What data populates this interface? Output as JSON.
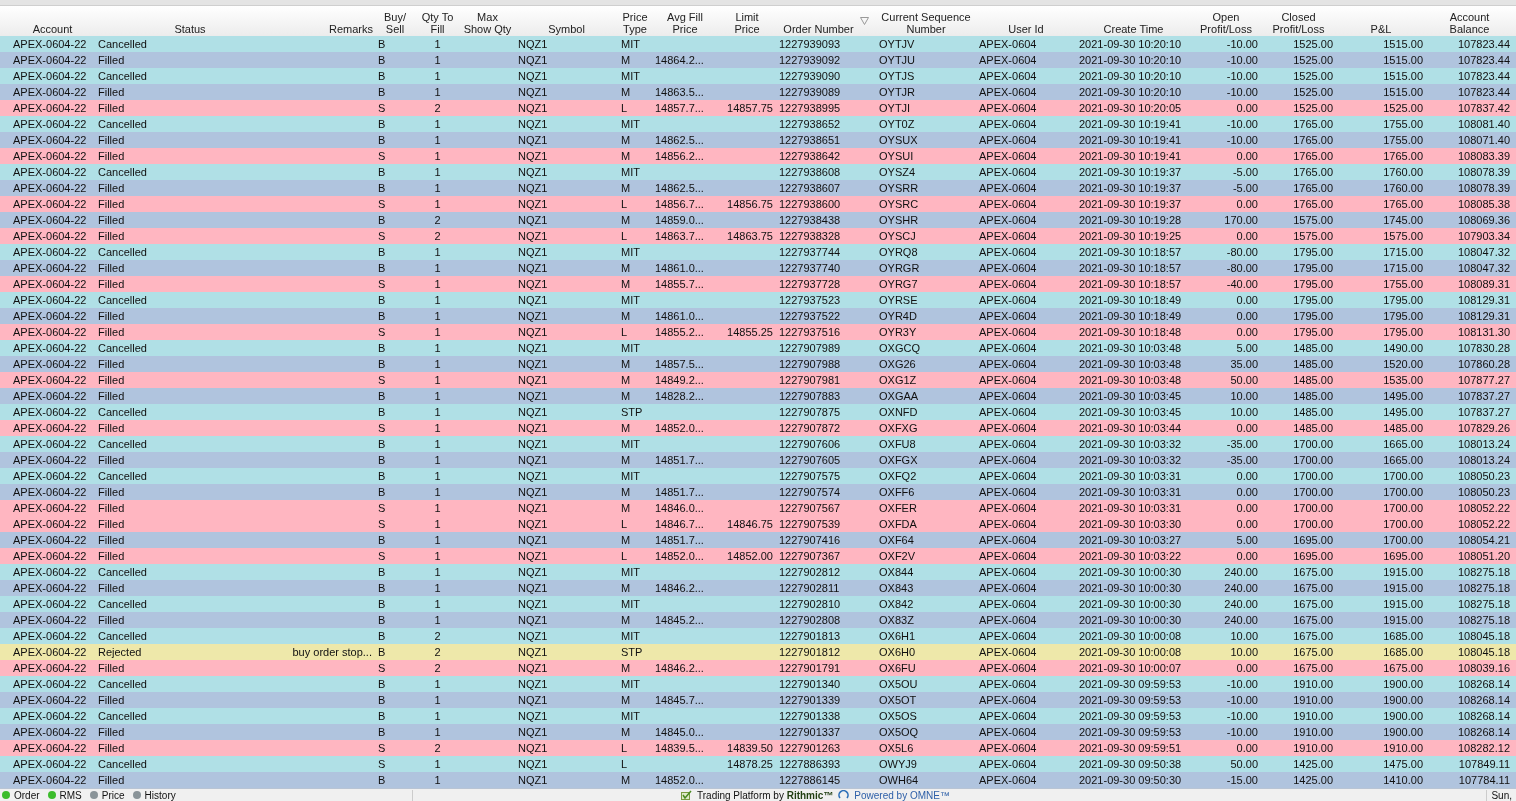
{
  "table": {
    "columns": [
      {
        "label": "Account",
        "sorted": false
      },
      {
        "label": "Status",
        "sorted": false
      },
      {
        "label": "Remarks",
        "sorted": false
      },
      {
        "label": "Buy/ Sell",
        "sorted": false
      },
      {
        "label": "Qty To Fill",
        "sorted": false
      },
      {
        "label": "Max Show Qty",
        "sorted": false
      },
      {
        "label": "Symbol",
        "sorted": false
      },
      {
        "label": "Price Type",
        "sorted": false
      },
      {
        "label": "Avg Fill Price",
        "sorted": false
      },
      {
        "label": "Limit Price",
        "sorted": false
      },
      {
        "label": "Order Number",
        "sorted": true
      },
      {
        "label": "Current Sequence Number",
        "sorted": false
      },
      {
        "label": "User Id",
        "sorted": false
      },
      {
        "label": "Create Time",
        "sorted": false
      },
      {
        "label": "Open Profit/Loss",
        "sorted": false
      },
      {
        "label": "Closed Profit/Loss",
        "sorted": false
      },
      {
        "label": "P&L",
        "sorted": false
      },
      {
        "label": "Account Balance",
        "sorted": false
      }
    ],
    "rows": [
      {
        "color": "#b0e0e6",
        "cells": [
          "APEX-0604-22",
          "Cancelled",
          null,
          "B",
          "1",
          null,
          "NQZ1",
          "MIT",
          null,
          null,
          "1227939093",
          "OYTJV",
          "APEX-0604",
          "2021-09-30 10:20:10",
          "-10.00",
          "1525.00",
          "1515.00",
          "107823.44"
        ]
      },
      {
        "color": "#b0c4de",
        "cells": [
          "APEX-0604-22",
          "Filled",
          null,
          "B",
          "1",
          null,
          "NQZ1",
          "M",
          "14864.2...",
          null,
          "1227939092",
          "OYTJU",
          "APEX-0604",
          "2021-09-30 10:20:10",
          "-10.00",
          "1525.00",
          "1515.00",
          "107823.44"
        ]
      },
      {
        "color": "#b0e0e6",
        "cells": [
          "APEX-0604-22",
          "Cancelled",
          null,
          "B",
          "1",
          null,
          "NQZ1",
          "MIT",
          null,
          null,
          "1227939090",
          "OYTJS",
          "APEX-0604",
          "2021-09-30 10:20:10",
          "-10.00",
          "1525.00",
          "1515.00",
          "107823.44"
        ]
      },
      {
        "color": "#b0c4de",
        "cells": [
          "APEX-0604-22",
          "Filled",
          null,
          "B",
          "1",
          null,
          "NQZ1",
          "M",
          "14863.5...",
          null,
          "1227939089",
          "OYTJR",
          "APEX-0604",
          "2021-09-30 10:20:10",
          "-10.00",
          "1525.00",
          "1515.00",
          "107823.44"
        ]
      },
      {
        "color": "#ffb6c1",
        "cells": [
          "APEX-0604-22",
          "Filled",
          null,
          "S",
          "2",
          null,
          "NQZ1",
          "L",
          "14857.7...",
          "14857.75",
          "1227938995",
          "OYTJI",
          "APEX-0604",
          "2021-09-30 10:20:05",
          "0.00",
          "1525.00",
          "1525.00",
          "107837.42"
        ]
      },
      {
        "color": "#b0e0e6",
        "cells": [
          "APEX-0604-22",
          "Cancelled",
          null,
          "B",
          "1",
          null,
          "NQZ1",
          "MIT",
          null,
          null,
          "1227938652",
          "OYT0Z",
          "APEX-0604",
          "2021-09-30 10:19:41",
          "-10.00",
          "1765.00",
          "1755.00",
          "108081.40"
        ]
      },
      {
        "color": "#b0c4de",
        "cells": [
          "APEX-0604-22",
          "Filled",
          null,
          "B",
          "1",
          null,
          "NQZ1",
          "M",
          "14862.5...",
          null,
          "1227938651",
          "OYSUX",
          "APEX-0604",
          "2021-09-30 10:19:41",
          "-10.00",
          "1765.00",
          "1755.00",
          "108071.40"
        ]
      },
      {
        "color": "#ffb6c1",
        "cells": [
          "APEX-0604-22",
          "Filled",
          null,
          "S",
          "1",
          null,
          "NQZ1",
          "M",
          "14856.2...",
          null,
          "1227938642",
          "OYSUI",
          "APEX-0604",
          "2021-09-30 10:19:41",
          "0.00",
          "1765.00",
          "1765.00",
          "108083.39"
        ]
      },
      {
        "color": "#b0e0e6",
        "cells": [
          "APEX-0604-22",
          "Cancelled",
          null,
          "B",
          "1",
          null,
          "NQZ1",
          "MIT",
          null,
          null,
          "1227938608",
          "OYSZ4",
          "APEX-0604",
          "2021-09-30 10:19:37",
          "-5.00",
          "1765.00",
          "1760.00",
          "108078.39"
        ]
      },
      {
        "color": "#b0c4de",
        "cells": [
          "APEX-0604-22",
          "Filled",
          null,
          "B",
          "1",
          null,
          "NQZ1",
          "M",
          "14862.5...",
          null,
          "1227938607",
          "OYSRR",
          "APEX-0604",
          "2021-09-30 10:19:37",
          "-5.00",
          "1765.00",
          "1760.00",
          "108078.39"
        ]
      },
      {
        "color": "#ffb6c1",
        "cells": [
          "APEX-0604-22",
          "Filled",
          null,
          "S",
          "1",
          null,
          "NQZ1",
          "L",
          "14856.7...",
          "14856.75",
          "1227938600",
          "OYSRC",
          "APEX-0604",
          "2021-09-30 10:19:37",
          "0.00",
          "1765.00",
          "1765.00",
          "108085.38"
        ]
      },
      {
        "color": "#b0c4de",
        "cells": [
          "APEX-0604-22",
          "Filled",
          null,
          "B",
          "2",
          null,
          "NQZ1",
          "M",
          "14859.0...",
          null,
          "1227938438",
          "OYSHR",
          "APEX-0604",
          "2021-09-30 10:19:28",
          "170.00",
          "1575.00",
          "1745.00",
          "108069.36"
        ]
      },
      {
        "color": "#ffb6c1",
        "cells": [
          "APEX-0604-22",
          "Filled",
          null,
          "S",
          "2",
          null,
          "NQZ1",
          "L",
          "14863.7...",
          "14863.75",
          "1227938328",
          "OYSCJ",
          "APEX-0604",
          "2021-09-30 10:19:25",
          "0.00",
          "1575.00",
          "1575.00",
          "107903.34"
        ]
      },
      {
        "color": "#b0e0e6",
        "cells": [
          "APEX-0604-22",
          "Cancelled",
          null,
          "B",
          "1",
          null,
          "NQZ1",
          "MIT",
          null,
          null,
          "1227937744",
          "OYRQ8",
          "APEX-0604",
          "2021-09-30 10:18:57",
          "-80.00",
          "1795.00",
          "1715.00",
          "108047.32"
        ]
      },
      {
        "color": "#b0c4de",
        "cells": [
          "APEX-0604-22",
          "Filled",
          null,
          "B",
          "1",
          null,
          "NQZ1",
          "M",
          "14861.0...",
          null,
          "1227937740",
          "OYRGR",
          "APEX-0604",
          "2021-09-30 10:18:57",
          "-80.00",
          "1795.00",
          "1715.00",
          "108047.32"
        ]
      },
      {
        "color": "#ffb6c1",
        "cells": [
          "APEX-0604-22",
          "Filled",
          null,
          "S",
          "1",
          null,
          "NQZ1",
          "M",
          "14855.7...",
          null,
          "1227937728",
          "OYRG7",
          "APEX-0604",
          "2021-09-30 10:18:57",
          "-40.00",
          "1795.00",
          "1755.00",
          "108089.31"
        ]
      },
      {
        "color": "#b0e0e6",
        "cells": [
          "APEX-0604-22",
          "Cancelled",
          null,
          "B",
          "1",
          null,
          "NQZ1",
          "MIT",
          null,
          null,
          "1227937523",
          "OYRSE",
          "APEX-0604",
          "2021-09-30 10:18:49",
          "0.00",
          "1795.00",
          "1795.00",
          "108129.31"
        ]
      },
      {
        "color": "#b0c4de",
        "cells": [
          "APEX-0604-22",
          "Filled",
          null,
          "B",
          "1",
          null,
          "NQZ1",
          "M",
          "14861.0...",
          null,
          "1227937522",
          "OYR4D",
          "APEX-0604",
          "2021-09-30 10:18:49",
          "0.00",
          "1795.00",
          "1795.00",
          "108129.31"
        ]
      },
      {
        "color": "#ffb6c1",
        "cells": [
          "APEX-0604-22",
          "Filled",
          null,
          "S",
          "1",
          null,
          "NQZ1",
          "L",
          "14855.2...",
          "14855.25",
          "1227937516",
          "OYR3Y",
          "APEX-0604",
          "2021-09-30 10:18:48",
          "0.00",
          "1795.00",
          "1795.00",
          "108131.30"
        ]
      },
      {
        "color": "#b0e0e6",
        "cells": [
          "APEX-0604-22",
          "Cancelled",
          null,
          "B",
          "1",
          null,
          "NQZ1",
          "MIT",
          null,
          null,
          "1227907989",
          "OXGCQ",
          "APEX-0604",
          "2021-09-30 10:03:48",
          "5.00",
          "1485.00",
          "1490.00",
          "107830.28"
        ]
      },
      {
        "color": "#b0c4de",
        "cells": [
          "APEX-0604-22",
          "Filled",
          null,
          "B",
          "1",
          null,
          "NQZ1",
          "M",
          "14857.5...",
          null,
          "1227907988",
          "OXG26",
          "APEX-0604",
          "2021-09-30 10:03:48",
          "35.00",
          "1485.00",
          "1520.00",
          "107860.28"
        ]
      },
      {
        "color": "#ffb6c1",
        "cells": [
          "APEX-0604-22",
          "Filled",
          null,
          "S",
          "1",
          null,
          "NQZ1",
          "M",
          "14849.2...",
          null,
          "1227907981",
          "OXG1Z",
          "APEX-0604",
          "2021-09-30 10:03:48",
          "50.00",
          "1485.00",
          "1535.00",
          "107877.27"
        ]
      },
      {
        "color": "#b0c4de",
        "cells": [
          "APEX-0604-22",
          "Filled",
          null,
          "B",
          "1",
          null,
          "NQZ1",
          "M",
          "14828.2...",
          null,
          "1227907883",
          "OXGAA",
          "APEX-0604",
          "2021-09-30 10:03:45",
          "10.00",
          "1485.00",
          "1495.00",
          "107837.27"
        ]
      },
      {
        "color": "#b0e0e6",
        "cells": [
          "APEX-0604-22",
          "Cancelled",
          null,
          "B",
          "1",
          null,
          "NQZ1",
          "STP",
          null,
          null,
          "1227907875",
          "OXNFD",
          "APEX-0604",
          "2021-09-30 10:03:45",
          "10.00",
          "1485.00",
          "1495.00",
          "107837.27"
        ]
      },
      {
        "color": "#ffb6c1",
        "cells": [
          "APEX-0604-22",
          "Filled",
          null,
          "S",
          "1",
          null,
          "NQZ1",
          "M",
          "14852.0...",
          null,
          "1227907872",
          "OXFXG",
          "APEX-0604",
          "2021-09-30 10:03:44",
          "0.00",
          "1485.00",
          "1485.00",
          "107829.26"
        ]
      },
      {
        "color": "#b0e0e6",
        "cells": [
          "APEX-0604-22",
          "Cancelled",
          null,
          "B",
          "1",
          null,
          "NQZ1",
          "MIT",
          null,
          null,
          "1227907606",
          "OXFU8",
          "APEX-0604",
          "2021-09-30 10:03:32",
          "-35.00",
          "1700.00",
          "1665.00",
          "108013.24"
        ]
      },
      {
        "color": "#b0c4de",
        "cells": [
          "APEX-0604-22",
          "Filled",
          null,
          "B",
          "1",
          null,
          "NQZ1",
          "M",
          "14851.7...",
          null,
          "1227907605",
          "OXFGX",
          "APEX-0604",
          "2021-09-30 10:03:32",
          "-35.00",
          "1700.00",
          "1665.00",
          "108013.24"
        ]
      },
      {
        "color": "#b0e0e6",
        "cells": [
          "APEX-0604-22",
          "Cancelled",
          null,
          "B",
          "1",
          null,
          "NQZ1",
          "MIT",
          null,
          null,
          "1227907575",
          "OXFQ2",
          "APEX-0604",
          "2021-09-30 10:03:31",
          "0.00",
          "1700.00",
          "1700.00",
          "108050.23"
        ]
      },
      {
        "color": "#b0c4de",
        "cells": [
          "APEX-0604-22",
          "Filled",
          null,
          "B",
          "1",
          null,
          "NQZ1",
          "M",
          "14851.7...",
          null,
          "1227907574",
          "OXFF6",
          "APEX-0604",
          "2021-09-30 10:03:31",
          "0.00",
          "1700.00",
          "1700.00",
          "108050.23"
        ]
      },
      {
        "color": "#ffb6c1",
        "cells": [
          "APEX-0604-22",
          "Filled",
          null,
          "S",
          "1",
          null,
          "NQZ1",
          "M",
          "14846.0...",
          null,
          "1227907567",
          "OXFER",
          "APEX-0604",
          "2021-09-30 10:03:31",
          "0.00",
          "1700.00",
          "1700.00",
          "108052.22"
        ]
      },
      {
        "color": "#ffb6c1",
        "cells": [
          "APEX-0604-22",
          "Filled",
          null,
          "S",
          "1",
          null,
          "NQZ1",
          "L",
          "14846.7...",
          "14846.75",
          "1227907539",
          "OXFDA",
          "APEX-0604",
          "2021-09-30 10:03:30",
          "0.00",
          "1700.00",
          "1700.00",
          "108052.22"
        ]
      },
      {
        "color": "#b0c4de",
        "cells": [
          "APEX-0604-22",
          "Filled",
          null,
          "B",
          "1",
          null,
          "NQZ1",
          "M",
          "14851.7...",
          null,
          "1227907416",
          "OXF64",
          "APEX-0604",
          "2021-09-30 10:03:27",
          "5.00",
          "1695.00",
          "1700.00",
          "108054.21"
        ]
      },
      {
        "color": "#ffb6c1",
        "cells": [
          "APEX-0604-22",
          "Filled",
          null,
          "S",
          "1",
          null,
          "NQZ1",
          "L",
          "14852.0...",
          "14852.00",
          "1227907367",
          "OXF2V",
          "APEX-0604",
          "2021-09-30 10:03:22",
          "0.00",
          "1695.00",
          "1695.00",
          "108051.20"
        ]
      },
      {
        "color": "#b0e0e6",
        "cells": [
          "APEX-0604-22",
          "Cancelled",
          null,
          "B",
          "1",
          null,
          "NQZ1",
          "MIT",
          null,
          null,
          "1227902812",
          "OX844",
          "APEX-0604",
          "2021-09-30 10:00:30",
          "240.00",
          "1675.00",
          "1915.00",
          "108275.18"
        ]
      },
      {
        "color": "#b0c4de",
        "cells": [
          "APEX-0604-22",
          "Filled",
          null,
          "B",
          "1",
          null,
          "NQZ1",
          "M",
          "14846.2...",
          null,
          "1227902811",
          "OX843",
          "APEX-0604",
          "2021-09-30 10:00:30",
          "240.00",
          "1675.00",
          "1915.00",
          "108275.18"
        ]
      },
      {
        "color": "#b0e0e6",
        "cells": [
          "APEX-0604-22",
          "Cancelled",
          null,
          "B",
          "1",
          null,
          "NQZ1",
          "MIT",
          null,
          null,
          "1227902810",
          "OX842",
          "APEX-0604",
          "2021-09-30 10:00:30",
          "240.00",
          "1675.00",
          "1915.00",
          "108275.18"
        ]
      },
      {
        "color": "#b0c4de",
        "cells": [
          "APEX-0604-22",
          "Filled",
          null,
          "B",
          "1",
          null,
          "NQZ1",
          "M",
          "14845.2...",
          null,
          "1227902808",
          "OX83Z",
          "APEX-0604",
          "2021-09-30 10:00:30",
          "240.00",
          "1675.00",
          "1915.00",
          "108275.18"
        ]
      },
      {
        "color": "#b0e0e6",
        "cells": [
          "APEX-0604-22",
          "Cancelled",
          null,
          "B",
          "2",
          null,
          "NQZ1",
          "MIT",
          null,
          null,
          "1227901813",
          "OX6H1",
          "APEX-0604",
          "2021-09-30 10:00:08",
          "10.00",
          "1675.00",
          "1685.00",
          "108045.18"
        ]
      },
      {
        "color": "#eee8aa",
        "cells": [
          "APEX-0604-22",
          "Rejected",
          "buy order stop...",
          "B",
          "2",
          null,
          "NQZ1",
          "STP",
          null,
          null,
          "1227901812",
          "OX6H0",
          "APEX-0604",
          "2021-09-30 10:00:08",
          "10.00",
          "1675.00",
          "1685.00",
          "108045.18"
        ]
      },
      {
        "color": "#ffb6c1",
        "cells": [
          "APEX-0604-22",
          "Filled",
          null,
          "S",
          "2",
          null,
          "NQZ1",
          "M",
          "14846.2...",
          null,
          "1227901791",
          "OX6FU",
          "APEX-0604",
          "2021-09-30 10:00:07",
          "0.00",
          "1675.00",
          "1675.00",
          "108039.16"
        ]
      },
      {
        "color": "#b0e0e6",
        "cells": [
          "APEX-0604-22",
          "Cancelled",
          null,
          "B",
          "1",
          null,
          "NQZ1",
          "MIT",
          null,
          null,
          "1227901340",
          "OX5OU",
          "APEX-0604",
          "2021-09-30 09:59:53",
          "-10.00",
          "1910.00",
          "1900.00",
          "108268.14"
        ]
      },
      {
        "color": "#b0c4de",
        "cells": [
          "APEX-0604-22",
          "Filled",
          null,
          "B",
          "1",
          null,
          "NQZ1",
          "M",
          "14845.7...",
          null,
          "1227901339",
          "OX5OT",
          "APEX-0604",
          "2021-09-30 09:59:53",
          "-10.00",
          "1910.00",
          "1900.00",
          "108268.14"
        ]
      },
      {
        "color": "#b0e0e6",
        "cells": [
          "APEX-0604-22",
          "Cancelled",
          null,
          "B",
          "1",
          null,
          "NQZ1",
          "MIT",
          null,
          null,
          "1227901338",
          "OX5OS",
          "APEX-0604",
          "2021-09-30 09:59:53",
          "-10.00",
          "1910.00",
          "1900.00",
          "108268.14"
        ]
      },
      {
        "color": "#b0c4de",
        "cells": [
          "APEX-0604-22",
          "Filled",
          null,
          "B",
          "1",
          null,
          "NQZ1",
          "M",
          "14845.0...",
          null,
          "1227901337",
          "OX5OQ",
          "APEX-0604",
          "2021-09-30 09:59:53",
          "-10.00",
          "1910.00",
          "1900.00",
          "108268.14"
        ]
      },
      {
        "color": "#ffb6c1",
        "cells": [
          "APEX-0604-22",
          "Filled",
          null,
          "S",
          "2",
          null,
          "NQZ1",
          "L",
          "14839.5...",
          "14839.50",
          "1227901263",
          "OX5L6",
          "APEX-0604",
          "2021-09-30 09:59:51",
          "0.00",
          "1910.00",
          "1910.00",
          "108282.12"
        ]
      },
      {
        "color": "#b0e0e6",
        "cells": [
          "APEX-0604-22",
          "Cancelled",
          null,
          "S",
          "1",
          null,
          "NQZ1",
          "L",
          null,
          "14878.25",
          "1227886393",
          "OWYJ9",
          "APEX-0604",
          "2021-09-30 09:50:38",
          "50.00",
          "1425.00",
          "1475.00",
          "107849.11"
        ]
      },
      {
        "color": "#b0c4de",
        "cells": [
          "APEX-0604-22",
          "Filled",
          null,
          "B",
          "1",
          null,
          "NQZ1",
          "M",
          "14852.0...",
          null,
          "1227886145",
          "OWH64",
          "APEX-0604",
          "2021-09-30 09:50:30",
          "-15.00",
          "1425.00",
          "1410.00",
          "107784.11"
        ]
      }
    ]
  },
  "status_bar": {
    "connections": [
      {
        "label": "Order",
        "on": true
      },
      {
        "label": "RMS",
        "on": true
      },
      {
        "label": "Price",
        "on": false
      },
      {
        "label": "History",
        "on": false
      }
    ],
    "platform": "Trading Platform by",
    "platform_brand": "Rithmic™",
    "powered": "Powered by OMNE™",
    "date": "Sun,"
  }
}
